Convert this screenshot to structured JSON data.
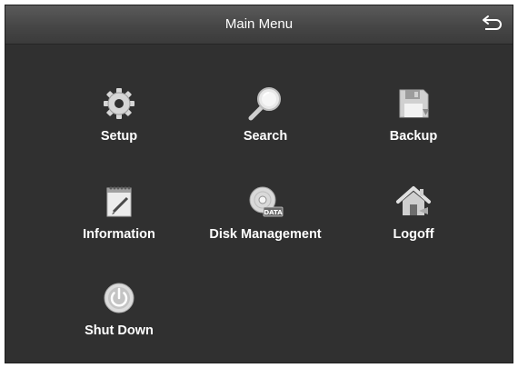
{
  "window": {
    "title": "Main Menu",
    "back_icon": "return-arrow-icon"
  },
  "menu": {
    "items": [
      {
        "label": "Setup",
        "icon": "gear-icon"
      },
      {
        "label": "Search",
        "icon": "magnifier-icon"
      },
      {
        "label": "Backup",
        "icon": "floppy-disk-icon"
      },
      {
        "label": "Information",
        "icon": "notepad-icon"
      },
      {
        "label": "Disk Management",
        "icon": "disk-data-icon"
      },
      {
        "label": "Logoff",
        "icon": "house-icon"
      },
      {
        "label": "Shut Down",
        "icon": "power-icon"
      }
    ]
  },
  "colors": {
    "background": "#303030",
    "titlebar": "#4a4a4a",
    "text": "#ffffff",
    "icon": "#d8d8d8"
  }
}
